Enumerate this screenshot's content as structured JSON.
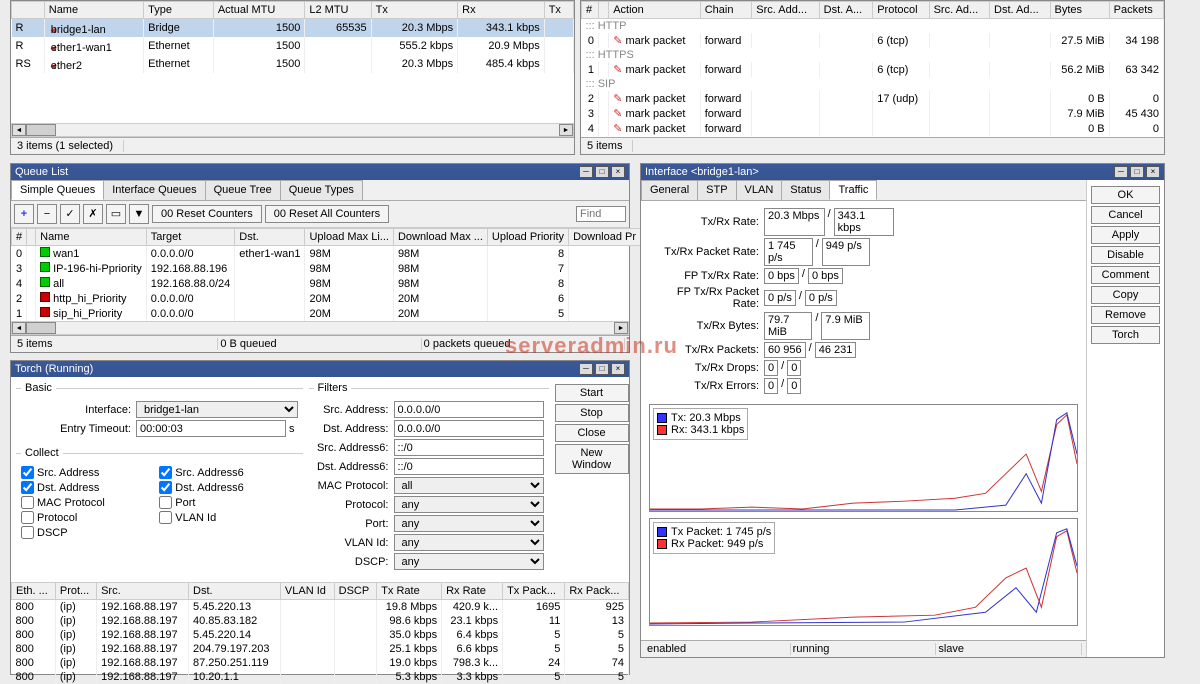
{
  "interfaces_table": {
    "headers": [
      "",
      "Name",
      "Type",
      "Actual MTU",
      "L2 MTU",
      "Tx",
      "Rx",
      "Tx"
    ],
    "rows": [
      {
        "flag": "R",
        "name": "bridge1-lan",
        "type": "Bridge",
        "mtu": "1500",
        "l2mtu": "65535",
        "tx": "20.3 Mbps",
        "rx": "343.1 kbps",
        "sel": true
      },
      {
        "flag": "R",
        "name": "ether1-wan1",
        "type": "Ethernet",
        "mtu": "1500",
        "l2mtu": "",
        "tx": "555.2 kbps",
        "rx": "20.9 Mbps"
      },
      {
        "flag": "RS",
        "name": "ether2",
        "type": "Ethernet",
        "mtu": "1500",
        "l2mtu": "",
        "tx": "20.3 Mbps",
        "rx": "485.4 kbps"
      }
    ],
    "status": "3 items (1 selected)"
  },
  "mangle_table": {
    "headers": [
      "#",
      "",
      "Action",
      "Chain",
      "Src. Add...",
      "Dst. A...",
      "Protocol",
      "Src. Ad...",
      "Dst. Ad...",
      "Bytes",
      "Packets"
    ],
    "groups": [
      {
        "label": "::: HTTP"
      },
      {
        "n": "0",
        "act": "mark packet",
        "chain": "forward",
        "proto": "6 (tcp)",
        "bytes": "27.5 MiB",
        "pkts": "34 198"
      },
      {
        "label": "::: HTTPS"
      },
      {
        "n": "1",
        "act": "mark packet",
        "chain": "forward",
        "proto": "6 (tcp)",
        "bytes": "56.2 MiB",
        "pkts": "63 342"
      },
      {
        "label": "::: SIP"
      },
      {
        "n": "2",
        "act": "mark packet",
        "chain": "forward",
        "proto": "17 (udp)",
        "bytes": "0 B",
        "pkts": "0"
      },
      {
        "n": "3",
        "act": "mark packet",
        "chain": "forward",
        "proto": "",
        "bytes": "7.9 MiB",
        "pkts": "45 430"
      },
      {
        "n": "4",
        "act": "mark packet",
        "chain": "forward",
        "proto": "",
        "bytes": "0 B",
        "pkts": "0"
      }
    ],
    "status": "5 items"
  },
  "queue": {
    "title": "Queue List",
    "tabs": [
      "Simple Queues",
      "Interface Queues",
      "Queue Tree",
      "Queue Types"
    ],
    "toolbar": {
      "reset": "00 Reset Counters",
      "resetall": "00 Reset All Counters",
      "find": "Find"
    },
    "headers": [
      "#",
      "",
      "Name",
      "Target",
      "Dst.",
      "Upload Max Li...",
      "Download Max ...",
      "Upload Priority",
      "Download Pr"
    ],
    "rows": [
      {
        "n": "0",
        "name": "wan1",
        "target": "0.0.0.0/0",
        "dst": "ether1-wan1",
        "ul": "98M",
        "dl": "98M",
        "up": "8",
        "en": true
      },
      {
        "n": "3",
        "name": "IP-196-hi-Ppriority",
        "target": "192.168.88.196",
        "dst": "",
        "ul": "98M",
        "dl": "98M",
        "up": "7",
        "en": true
      },
      {
        "n": "4",
        "name": "all",
        "target": "192.168.88.0/24",
        "dst": "",
        "ul": "98M",
        "dl": "98M",
        "up": "8",
        "en": true
      },
      {
        "n": "2",
        "name": "http_hi_Priority",
        "target": "0.0.0.0/0",
        "dst": "",
        "ul": "20M",
        "dl": "20M",
        "up": "6",
        "en": false
      },
      {
        "n": "1",
        "name": "sip_hi_Priority",
        "target": "0.0.0.0/0",
        "dst": "",
        "ul": "20M",
        "dl": "20M",
        "up": "5",
        "en": false
      }
    ],
    "status": [
      "5 items",
      "0 B queued",
      "0 packets queued"
    ]
  },
  "torch": {
    "title": "Torch (Running)",
    "basic_label": "Basic",
    "filters_label": "Filters",
    "collect_label": "Collect",
    "interface": "bridge1-lan",
    "timeout": "00:00:03",
    "src_addr": "0.0.0.0/0",
    "dst_addr": "0.0.0.0/0",
    "src_addr6": "::/0",
    "dst_addr6": "::/0",
    "mac_proto": "all",
    "protocol": "any",
    "port": "any",
    "vlan": "any",
    "dscp": "any",
    "buttons": {
      "start": "Start",
      "stop": "Stop",
      "close": "Close",
      "neww": "New Window"
    },
    "checks": {
      "src": "Src. Address",
      "src6": "Src. Address6",
      "dst": "Dst. Address",
      "dst6": "Dst. Address6",
      "mac": "MAC Protocol",
      "port": "Port",
      "proto": "Protocol",
      "vlan": "VLAN Id",
      "dscp": "DSCP"
    },
    "labels": {
      "interface": "Interface:",
      "timeout": "Entry Timeout:",
      "srcaddr": "Src. Address:",
      "dstaddr": "Dst. Address:",
      "srcaddr6": "Src. Address6:",
      "dstaddr6": "Dst. Address6:",
      "macproto": "MAC Protocol:",
      "protocol": "Protocol:",
      "port": "Port:",
      "vlanid": "VLAN Id:",
      "dscp": "DSCP:"
    },
    "theaders": [
      "Eth. ...",
      "Prot...",
      "Src.",
      "Dst.",
      "VLAN Id",
      "DSCP",
      "Tx Rate",
      "Rx Rate",
      "Tx Pack...",
      "Rx Pack..."
    ],
    "trows": [
      {
        "e": "800",
        "p": "(ip)",
        "s": "192.168.88.197",
        "d": "5.45.220.13",
        "tx": "19.8 Mbps",
        "rx": "420.9 k...",
        "txp": "1695",
        "rxp": "925"
      },
      {
        "e": "800",
        "p": "(ip)",
        "s": "192.168.88.197",
        "d": "40.85.83.182",
        "tx": "98.6 kbps",
        "rx": "23.1 kbps",
        "txp": "11",
        "rxp": "13"
      },
      {
        "e": "800",
        "p": "(ip)",
        "s": "192.168.88.197",
        "d": "5.45.220.14",
        "tx": "35.0 kbps",
        "rx": "6.4 kbps",
        "txp": "5",
        "rxp": "5"
      },
      {
        "e": "800",
        "p": "(ip)",
        "s": "192.168.88.197",
        "d": "204.79.197.203",
        "tx": "25.1 kbps",
        "rx": "6.6 kbps",
        "txp": "5",
        "rxp": "5"
      },
      {
        "e": "800",
        "p": "(ip)",
        "s": "192.168.88.197",
        "d": "87.250.251.119",
        "tx": "19.0 kbps",
        "rx": "798.3 k...",
        "txp": "24",
        "rxp": "74"
      },
      {
        "e": "800",
        "p": "(ip)",
        "s": "192.168.88.197",
        "d": "10.20.1.1",
        "tx": "5.3 kbps",
        "rx": "3.3 kbps",
        "txp": "5",
        "rxp": "5"
      }
    ]
  },
  "iface": {
    "title": "Interface <bridge1-lan>",
    "tabs": [
      "General",
      "STP",
      "VLAN",
      "Status",
      "Traffic"
    ],
    "rows": [
      {
        "l": "Tx/Rx Rate:",
        "a": "20.3 Mbps",
        "b": "343.1 kbps"
      },
      {
        "l": "Tx/Rx Packet Rate:",
        "a": "1 745 p/s",
        "b": "949 p/s"
      },
      {
        "l": "FP Tx/Rx Rate:",
        "a": "0 bps",
        "b": "0 bps"
      },
      {
        "l": "FP Tx/Rx Packet Rate:",
        "a": "0 p/s",
        "b": "0 p/s"
      },
      {
        "l": "Tx/Rx Bytes:",
        "a": "79.7 MiB",
        "b": "7.9 MiB"
      },
      {
        "l": "Tx/Rx Packets:",
        "a": "60 956",
        "b": "46 231"
      },
      {
        "l": "Tx/Rx Drops:",
        "a": "0",
        "b": "0"
      },
      {
        "l": "Tx/Rx Errors:",
        "a": "0",
        "b": "0"
      }
    ],
    "buttons": [
      "OK",
      "Cancel",
      "Apply",
      "Disable",
      "Comment",
      "Copy",
      "Remove",
      "Torch"
    ],
    "g1": {
      "tx": "Tx: 20.3 Mbps",
      "rx": "Rx: 343.1 kbps"
    },
    "g2": {
      "tx": "Tx Packet: 1 745 p/s",
      "rx": "Rx Packet: 949 p/s"
    },
    "status": [
      "enabled",
      "running",
      "slave"
    ]
  },
  "watermark": "serveradmin.ru",
  "chart_data": [
    {
      "type": "line",
      "title": "Tx/Rx Rate",
      "series": [
        {
          "name": "Tx",
          "color": "#3030ff",
          "unit": "Mbps",
          "current": 20.3
        },
        {
          "name": "Rx",
          "color": "#ff3030",
          "unit": "kbps",
          "current": 343.1
        }
      ],
      "note": "time-series magnitudes approximate; only current values labeled"
    },
    {
      "type": "line",
      "title": "Tx/Rx Packet Rate",
      "series": [
        {
          "name": "Tx Packet",
          "color": "#3030ff",
          "unit": "p/s",
          "current": 1745
        },
        {
          "name": "Rx Packet",
          "color": "#ff3030",
          "unit": "p/s",
          "current": 949
        }
      ]
    }
  ]
}
